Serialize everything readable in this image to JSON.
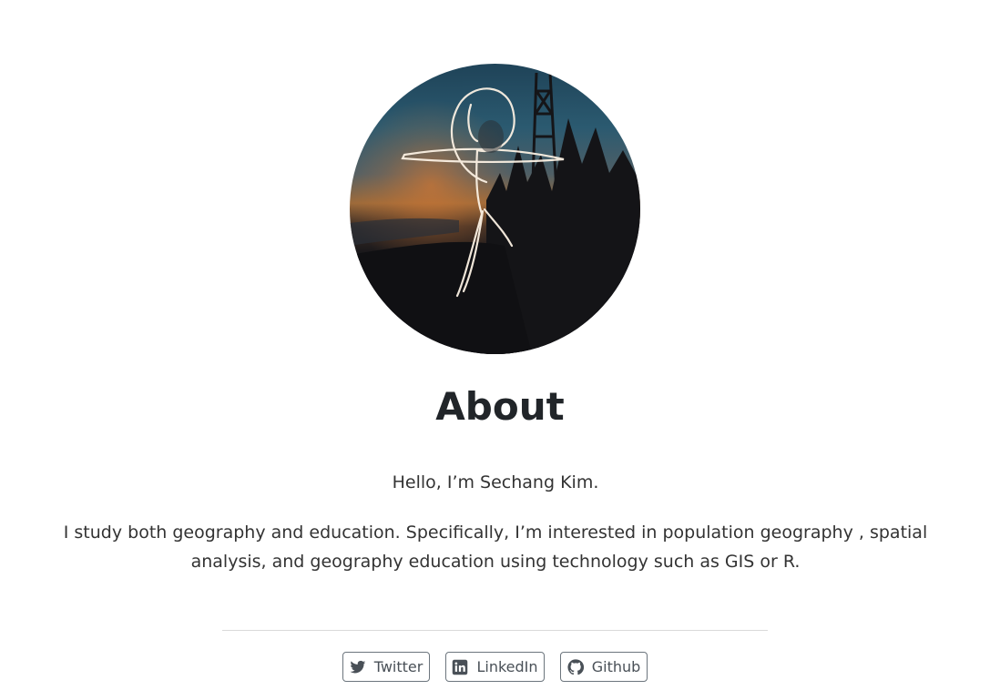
{
  "profile": {
    "avatar_alt": "light painting stick figure at dusk"
  },
  "about": {
    "title": "About",
    "greeting": "Hello, I’m Sechang Kim.",
    "bio": "I study both geography and education. Specifically, I’m interested in population geography , spatial analysis, and geography education using technology such as GIS or R."
  },
  "social": {
    "twitter": {
      "label": "Twitter",
      "icon": "twitter-icon"
    },
    "linkedin": {
      "label": "LinkedIn",
      "icon": "linkedin-icon"
    },
    "github": {
      "label": "Github",
      "icon": "github-icon"
    }
  }
}
